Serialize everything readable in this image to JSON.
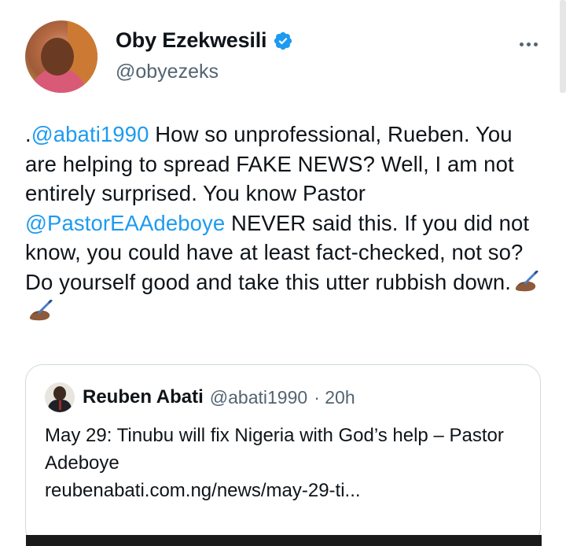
{
  "author": {
    "display_name": "Oby Ezekwesili",
    "handle": "@obyezeks",
    "verified": true,
    "verified_color": "#1d9bf0"
  },
  "more_icon": "more-horizontal-icon",
  "tweet": {
    "segments": [
      {
        "type": "text",
        "value": "."
      },
      {
        "type": "mention",
        "value": "@abati1990"
      },
      {
        "type": "text",
        "value": " How so unprofessional, Rueben.  You are helping to spread FAKE NEWS? Well, I am not entirely surprised. You know Pastor "
      },
      {
        "type": "mention",
        "value": "@PastorEAAdeboye"
      },
      {
        "type": "text",
        "value": " NEVER said this. If you did not know, you could have at least fact-checked, not so?  Do yourself good and take this utter rubbish down."
      }
    ],
    "emojis": [
      "writing-hand-emoji",
      "writing-hand-emoji"
    ]
  },
  "quote": {
    "display_name": "Reuben Abati",
    "handle": "@abati1990",
    "time": "· 20h",
    "text": "May 29: Tinubu will fix Nigeria with God’s help – Pastor Adeboye",
    "link": "reubenabati.com.ng/news/may-29-ti..."
  },
  "colors": {
    "text": "#0f1419",
    "secondary": "#536471",
    "link": "#1d9bf0",
    "border": "#cfd9de"
  }
}
